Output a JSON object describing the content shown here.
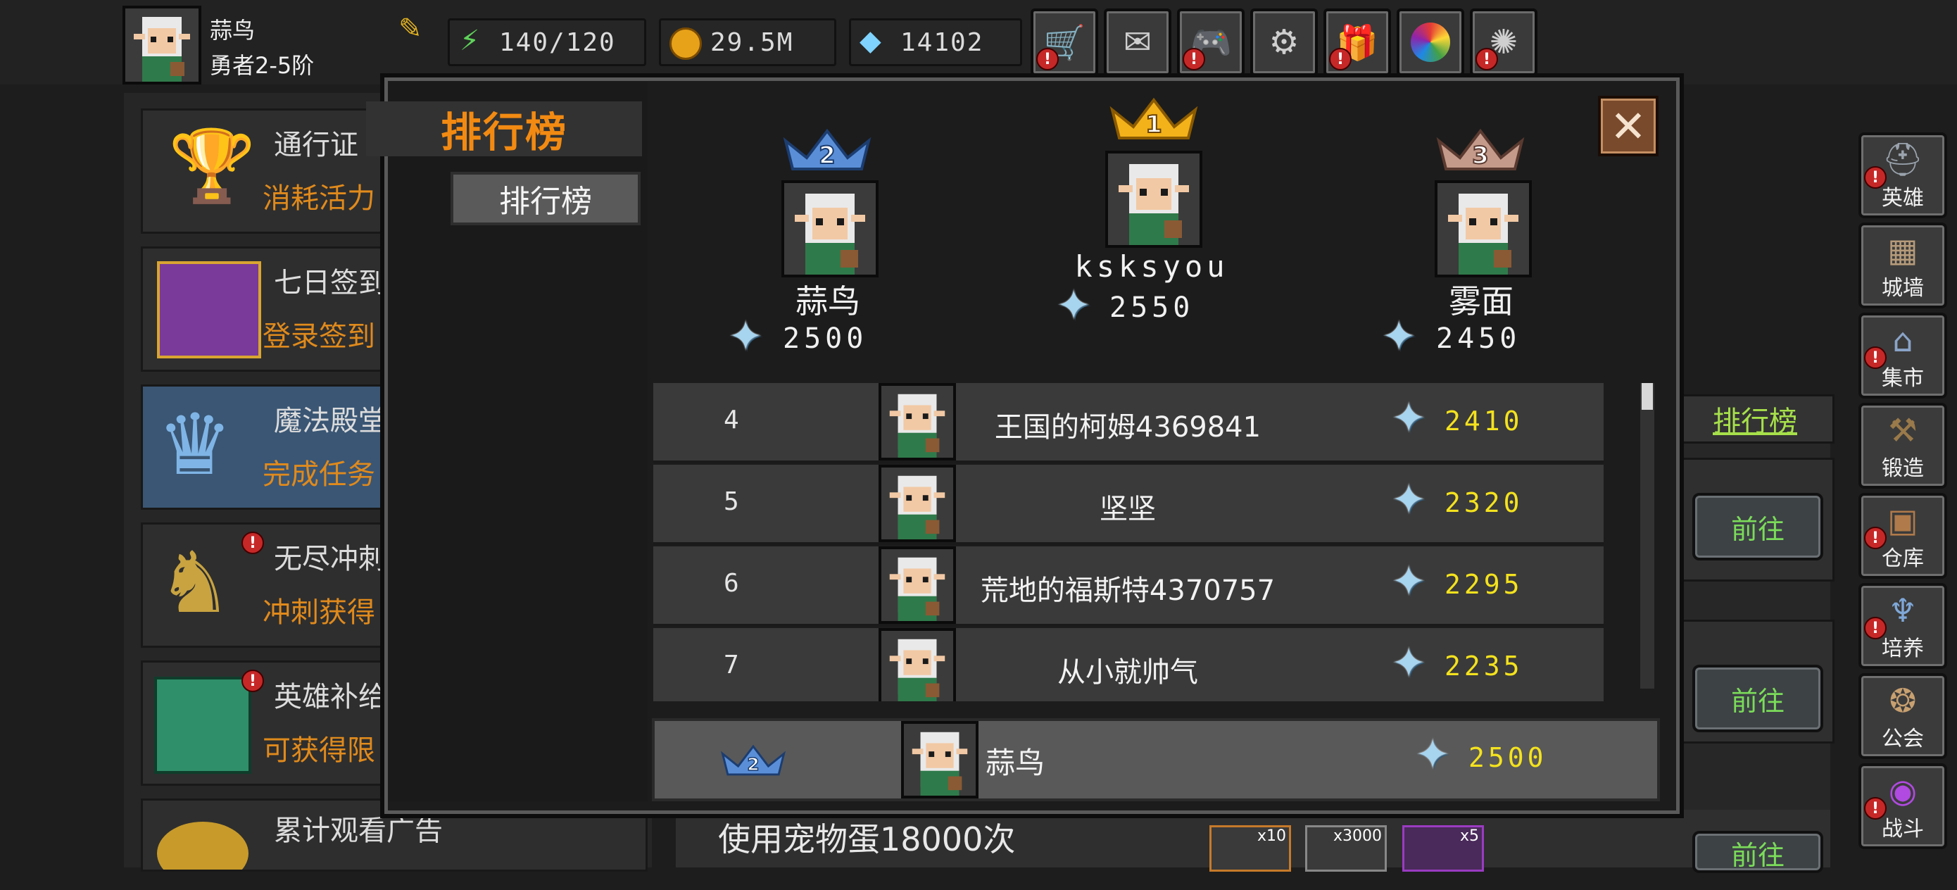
{
  "player": {
    "name": "蒜鸟",
    "rank": "勇者2-5阶"
  },
  "resources": [
    {
      "icon": "energy-icon",
      "value": "140/120"
    },
    {
      "icon": "gold-coin-icon",
      "value": "29.5M"
    },
    {
      "icon": "diamond-icon",
      "value": "14102"
    }
  ],
  "top_icons": [
    {
      "name": "shop-cart-icon",
      "alert": true
    },
    {
      "name": "mail-icon",
      "alert": false
    },
    {
      "name": "gamepad-icon",
      "alert": true
    },
    {
      "name": "settings-gear-icon",
      "alert": false
    },
    {
      "name": "gift-icon",
      "alert": true
    },
    {
      "name": "color-wheel-icon",
      "alert": false
    },
    {
      "name": "fireworks-icon",
      "alert": true
    }
  ],
  "activities": [
    {
      "title": "通行证",
      "sub": "消耗活力",
      "icon": "goblet-icon"
    },
    {
      "title": "七日签到",
      "sub": "登录签到",
      "icon": "treasure-chest-icon"
    },
    {
      "title": "魔法殿堂",
      "sub": "完成任务",
      "icon": "crystal-throne-icon"
    },
    {
      "title": "无尽冲刺",
      "sub": "冲刺获得",
      "icon": "knight-armor-icon"
    },
    {
      "title": "英雄补给",
      "sub": "可获得限",
      "icon": "jade-stack-icon"
    },
    {
      "title": "累计观看广告",
      "sub": "",
      "icon": "gold-pile-icon"
    }
  ],
  "right_menu": [
    {
      "label": "英雄",
      "icon": "helmet-icon",
      "alert": true
    },
    {
      "label": "城墙",
      "icon": "wall-icon",
      "alert": false
    },
    {
      "label": "集市",
      "icon": "market-icon",
      "alert": true
    },
    {
      "label": "锻造",
      "icon": "anvil-icon",
      "alert": false
    },
    {
      "label": "仓库",
      "icon": "warehouse-icon",
      "alert": true
    },
    {
      "label": "培养",
      "icon": "chalice-icon",
      "alert": true
    },
    {
      "label": "公会",
      "icon": "guild-beast-icon",
      "alert": false
    },
    {
      "label": "战斗",
      "icon": "portal-icon",
      "alert": true
    }
  ],
  "background_panel": {
    "tab_label": "排行榜",
    "go_label": "前往",
    "task_text": "使用宠物蛋18000次",
    "reward_counts": [
      "x10",
      "x3000",
      "x5"
    ]
  },
  "modal": {
    "title": "排行榜",
    "tab": "排行榜",
    "podium": [
      {
        "place": "1",
        "name": "ksksyou",
        "score": "2550"
      },
      {
        "place": "2",
        "name": "蒜鸟",
        "score": "2500"
      },
      {
        "place": "3",
        "name": "雾面",
        "score": "2450"
      }
    ],
    "rows": [
      {
        "rank": "4",
        "name": "王国的柯姆4369841",
        "score": "2410"
      },
      {
        "rank": "5",
        "name": "坚坚",
        "score": "2320"
      },
      {
        "rank": "6",
        "name": "荒地的福斯特4370757",
        "score": "2295"
      },
      {
        "rank": "7",
        "name": "从小就帅气",
        "score": "2235"
      }
    ],
    "self": {
      "place": "2",
      "name": "蒜鸟",
      "score": "2500"
    }
  }
}
